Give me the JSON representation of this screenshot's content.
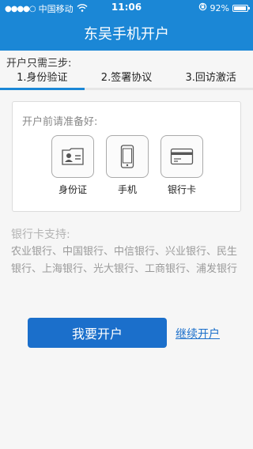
{
  "status_bar": {
    "signal_dots": "●●●●○",
    "carrier": "中国移动",
    "time": "11:06",
    "battery_percent": "92%",
    "battery_level": 0.92
  },
  "header": {
    "title": "东吴手机开户"
  },
  "steps": {
    "title": "开户只需三步:",
    "items": [
      "1.身份验证",
      "2.签署协议",
      "3.回访激活"
    ],
    "current_progress": 0.333
  },
  "prep": {
    "title": "开户前请准备好:",
    "items": [
      {
        "label": "身份证",
        "icon": "id-card-icon"
      },
      {
        "label": "手机",
        "icon": "phone-icon"
      },
      {
        "label": "银行卡",
        "icon": "bank-card-icon"
      }
    ]
  },
  "banks": {
    "title": "银行卡支持:",
    "list": "农业银行、中国银行、中信银行、兴业银行、民生银行、上海银行、光大银行、工商银行、浦发银行"
  },
  "actions": {
    "open_account": "我要开户",
    "continue_account": "继续开户"
  },
  "colors": {
    "brand": "#1b87d6",
    "button": "#1b6fcb"
  }
}
